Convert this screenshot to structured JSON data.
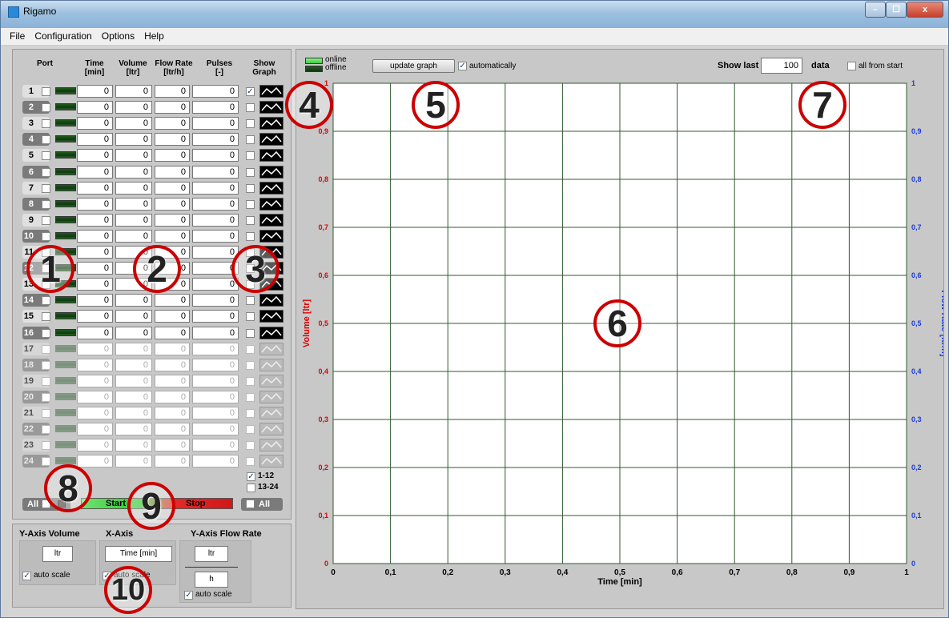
{
  "window": {
    "title": "Rigamo",
    "min": "–",
    "max": "☐",
    "close": "x"
  },
  "menu": [
    "File",
    "Configuration",
    "Options",
    "Help"
  ],
  "table": {
    "headers": {
      "port": "Port",
      "time": "Time\n[min]",
      "volume": "Volume\n[ltr]",
      "flow": "Flow Rate\n[ltr/h]",
      "pulses": "Pulses\n[-]",
      "show": "Show\nGraph"
    },
    "rows": [
      {
        "port": "1",
        "time": "0",
        "volume": "0",
        "flow": "0",
        "pulses": "0",
        "show": "✓"
      },
      {
        "port": "2",
        "time": "0",
        "volume": "0",
        "flow": "0",
        "pulses": "0",
        "show": ""
      },
      {
        "port": "3",
        "time": "0",
        "volume": "0",
        "flow": "0",
        "pulses": "0",
        "show": ""
      },
      {
        "port": "4",
        "time": "0",
        "volume": "0",
        "flow": "0",
        "pulses": "0",
        "show": ""
      },
      {
        "port": "5",
        "time": "0",
        "volume": "0",
        "flow": "0",
        "pulses": "0",
        "show": ""
      },
      {
        "port": "6",
        "time": "0",
        "volume": "0",
        "flow": "0",
        "pulses": "0",
        "show": ""
      },
      {
        "port": "7",
        "time": "0",
        "volume": "0",
        "flow": "0",
        "pulses": "0",
        "show": ""
      },
      {
        "port": "8",
        "time": "0",
        "volume": "0",
        "flow": "0",
        "pulses": "0",
        "show": ""
      },
      {
        "port": "9",
        "time": "0",
        "volume": "0",
        "flow": "0",
        "pulses": "0",
        "show": ""
      },
      {
        "port": "10",
        "time": "0",
        "volume": "0",
        "flow": "0",
        "pulses": "0",
        "show": ""
      },
      {
        "port": "11",
        "time": "0",
        "volume": "0",
        "flow": "0",
        "pulses": "0",
        "show": ""
      },
      {
        "port": "12",
        "time": "0",
        "volume": "0",
        "flow": "0",
        "pulses": "0",
        "show": ""
      },
      {
        "port": "13",
        "time": "0",
        "volume": "0",
        "flow": "0",
        "pulses": "0",
        "show": ""
      },
      {
        "port": "14",
        "time": "0",
        "volume": "0",
        "flow": "0",
        "pulses": "0",
        "show": ""
      },
      {
        "port": "15",
        "time": "0",
        "volume": "0",
        "flow": "0",
        "pulses": "0",
        "show": ""
      },
      {
        "port": "16",
        "time": "0",
        "volume": "0",
        "flow": "0",
        "pulses": "0",
        "show": ""
      },
      {
        "port": "17",
        "time": "0",
        "volume": "0",
        "flow": "0",
        "pulses": "0",
        "show": ""
      },
      {
        "port": "18",
        "time": "0",
        "volume": "0",
        "flow": "0",
        "pulses": "0",
        "show": ""
      },
      {
        "port": "19",
        "time": "0",
        "volume": "0",
        "flow": "0",
        "pulses": "0",
        "show": ""
      },
      {
        "port": "20",
        "time": "0",
        "volume": "0",
        "flow": "0",
        "pulses": "0",
        "show": ""
      },
      {
        "port": "21",
        "time": "0",
        "volume": "0",
        "flow": "0",
        "pulses": "0",
        "show": ""
      },
      {
        "port": "22",
        "time": "0",
        "volume": "0",
        "flow": "0",
        "pulses": "0",
        "show": ""
      },
      {
        "port": "23",
        "time": "0",
        "volume": "0",
        "flow": "0",
        "pulses": "0",
        "show": ""
      },
      {
        "port": "24",
        "time": "0",
        "volume": "0",
        "flow": "0",
        "pulses": "0",
        "show": ""
      }
    ],
    "enabled_ports": 16
  },
  "ranges": {
    "r1": "1-12",
    "r2": "13-24",
    "r1_checked": "✓"
  },
  "controls": {
    "all_left": "All",
    "start": "Start",
    "stop": "Stop",
    "all_right": "All"
  },
  "axes": {
    "y_volume_title": "Y-Axis Volume",
    "y_volume_unit": "ltr",
    "y_volume_auto": "auto scale",
    "x_title": "X-Axis",
    "x_unit": "Time [min]",
    "x_auto": "auto scale",
    "y_flow_title": "Y-Axis Flow Rate",
    "y_flow_unit_top": "ltr",
    "y_flow_unit_bottom": "h",
    "y_flow_auto": "auto scale"
  },
  "graph_controls": {
    "online": "online",
    "offline": "offline",
    "update": "update graph",
    "auto": "automatically",
    "show_last": "Show last",
    "show_last_value": "100",
    "data": "data",
    "all_from_start": "all from start"
  },
  "chart_data": {
    "type": "line",
    "xlabel": "Time [min]",
    "ylabel": "Volume [ltr]",
    "y2label": "Flow Rate [ltr/h]",
    "xlim": [
      0,
      1
    ],
    "ylim": [
      0,
      1
    ],
    "y2lim": [
      0,
      1
    ],
    "xticks": [
      "0",
      "0,1",
      "0,2",
      "0,3",
      "0,4",
      "0,5",
      "0,6",
      "0,7",
      "0,8",
      "0,9",
      "1"
    ],
    "yticks": [
      "0",
      "0,1",
      "0,2",
      "0,3",
      "0,4",
      "0,5",
      "0,6",
      "0,7",
      "0,8",
      "0,9",
      "1"
    ],
    "y2ticks": [
      "0",
      "0,1",
      "0,2",
      "0,3",
      "0,4",
      "0,5",
      "0,6",
      "0,7",
      "0,8",
      "0,9",
      "1"
    ],
    "grid": true,
    "series": [],
    "colors": {
      "y_axis": "#e00000",
      "y2_axis": "#1a3cd6",
      "grid": "#2f5a2f"
    }
  },
  "markers": [
    "1",
    "2",
    "3",
    "4",
    "5",
    "6",
    "7",
    "8",
    "9",
    "10"
  ]
}
